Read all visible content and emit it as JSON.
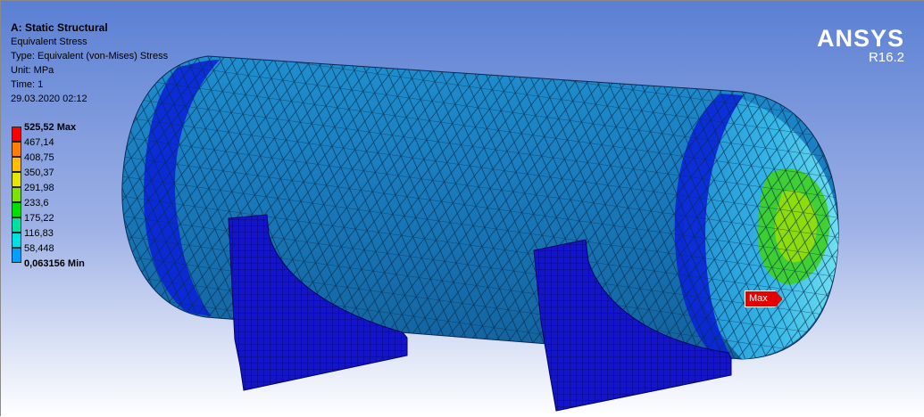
{
  "analysis": {
    "title": "A: Static Structural",
    "result_name": "Equivalent Stress",
    "type": "Type: Equivalent (von-Mises) Stress",
    "unit": "Unit: MPa",
    "time": "Time: 1",
    "date": "29.03.2020 02:12"
  },
  "legend": {
    "entries": [
      {
        "label": "525,52 Max",
        "color": "#ff0000",
        "bold": true
      },
      {
        "label": "467,14",
        "color": "#ff7f00",
        "bold": false
      },
      {
        "label": "408,75",
        "color": "#ffbf00",
        "bold": false
      },
      {
        "label": "350,37",
        "color": "#e6e600",
        "bold": false
      },
      {
        "label": "291,98",
        "color": "#80e000",
        "bold": false
      },
      {
        "label": "233,6",
        "color": "#00e000",
        "bold": false
      },
      {
        "label": "175,22",
        "color": "#00e0a0",
        "bold": false
      },
      {
        "label": "116,83",
        "color": "#00e0e0",
        "bold": false
      },
      {
        "label": "58,448",
        "color": "#00a0ff",
        "bold": false
      },
      {
        "label": "0,063156 Min",
        "color": "#0000ff",
        "bold": true
      }
    ]
  },
  "logo": {
    "brand": "ANSYS",
    "version": "R16.2"
  },
  "probe": {
    "max_label": "Max"
  },
  "colors": {
    "shell": "#1e7ec2",
    "low_band": "#0a22d8",
    "support": "#1414c8",
    "hot_zone": "#3ed020",
    "warm_zone": "#36e0e8"
  }
}
